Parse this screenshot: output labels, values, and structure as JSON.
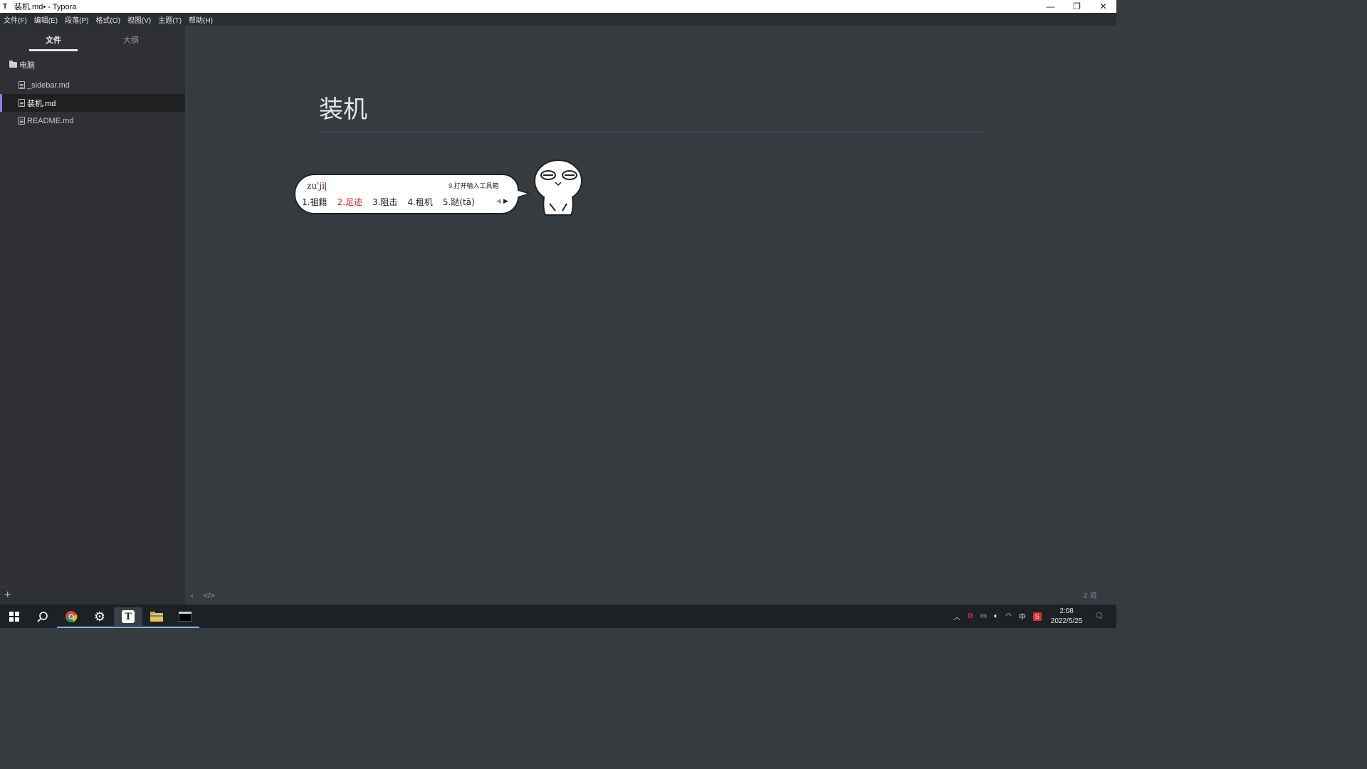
{
  "window": {
    "app_icon": "T",
    "title": "装机.md• - Typora"
  },
  "menu": [
    "文件(F)",
    "编辑(E)",
    "段落(P)",
    "格式(O)",
    "视图(V)",
    "主题(T)",
    "帮助(H)"
  ],
  "sidebar": {
    "tabs": [
      "文件",
      "大纲"
    ],
    "folder": "电脑",
    "files": [
      "_sidebar.md",
      "装机.md",
      "README.md"
    ],
    "active_file_index": 1,
    "add_label": "+"
  },
  "editor": {
    "title": "装机",
    "word_count": "2 词"
  },
  "ime": {
    "pinyin": "zu'ji",
    "toolbox": "9.打开输入工具箱",
    "candidates": [
      "1.祖籍",
      "2.足迹",
      "3.阻击",
      "4.租机",
      "5.跶(tā)"
    ],
    "highlight_index": 1
  },
  "taskbar": {
    "apps": [
      "start-icon",
      "search-icon",
      "chrome-icon",
      "settings-icon",
      "typora-icon",
      "file-explorer-icon",
      "terminal-icon"
    ],
    "tray_lang": "中",
    "time": "2:08",
    "date": "2022/5/25"
  },
  "colors": {
    "editor_bg": "#363b40",
    "sidebar_bg": "#2e3033",
    "active_accent": "#8d7cf0",
    "candidate_highlight": "#e02020"
  }
}
